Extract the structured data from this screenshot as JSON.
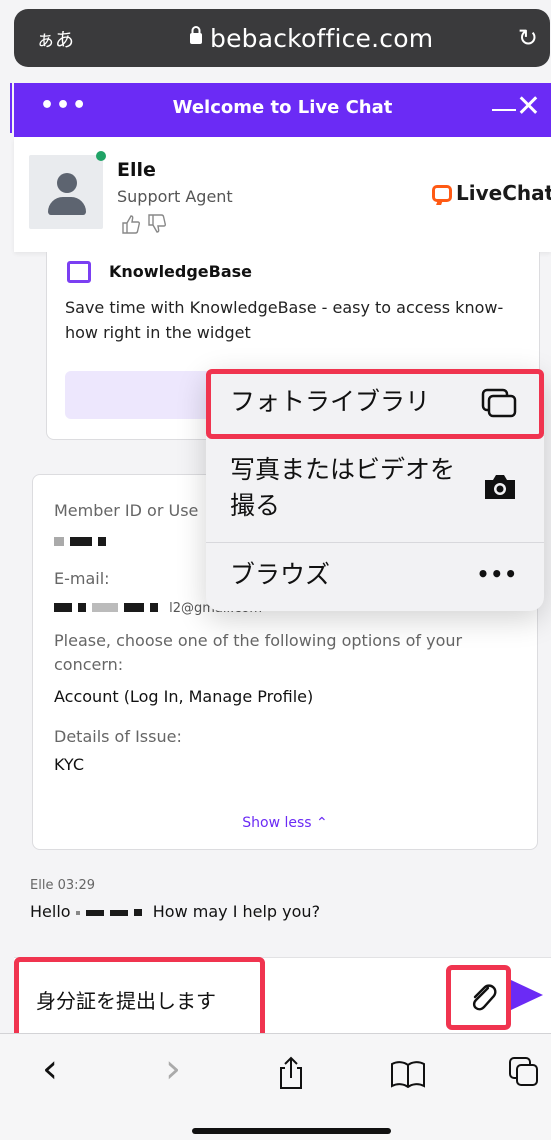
{
  "browser": {
    "text_size_label": "ぁあ",
    "domain": "bebackoffice.com",
    "reload_icon": "↻"
  },
  "chat_header": {
    "title": "Welcome to Live Chat",
    "menu_icon": "•••",
    "close_icon": "✕"
  },
  "agent": {
    "name": "Elle",
    "role": "Support Agent",
    "brand": "LiveChat",
    "status_color": "#20a366"
  },
  "knowledge_card": {
    "title": "KnowledgeBase",
    "text": "Save time with KnowledgeBase - easy to access know-how right in the widget"
  },
  "form_card": {
    "member_id_label": "Member ID or Use",
    "email_label": "E-mail:",
    "email_visible_part": "l2@gmail.com",
    "concern_label": "Please, choose one of the following options of your concern:",
    "concern_value": "Account (Log In, Manage Profile)",
    "details_label": "Details of Issue:",
    "details_value": "KYC",
    "show_less": "Show less ⌃"
  },
  "message": {
    "meta": "Elle 03:29",
    "greeting_start": "Hello",
    "greeting_end": "How may I help you?"
  },
  "context_menu": {
    "items": [
      {
        "label": "フォトライブラリ",
        "icon": "photo-library-icon"
      },
      {
        "label": "写真またはビデオを撮る",
        "line1": "写真またはビデオを",
        "line2": "撮る",
        "icon": "camera-icon"
      },
      {
        "label": "ブラウズ",
        "icon": "more-icon"
      }
    ]
  },
  "composer": {
    "text": "身分証を提出します",
    "attach_icon": "🖇",
    "accent": "#6b2bf5"
  },
  "toolbar": {
    "back": "‹",
    "forward": "›"
  },
  "colors": {
    "accent": "#6b2bf5",
    "highlight": "#f0344f"
  }
}
